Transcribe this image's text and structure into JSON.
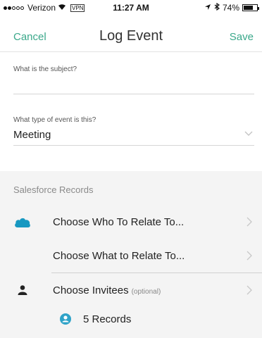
{
  "status_bar": {
    "carrier": "Verizon",
    "vpn": "VPN",
    "time": "11:27 AM",
    "battery": "74%",
    "battery_level": 0.74
  },
  "nav": {
    "cancel_label": "Cancel",
    "title": "Log Event",
    "save_label": "Save"
  },
  "form": {
    "subject_label": "What is the subject?",
    "subject_value": "",
    "event_type_label": "What type of event is this?",
    "event_type_value": "Meeting"
  },
  "salesforce": {
    "header": "Salesforce Records",
    "rows": [
      {
        "label": "Choose Who To Relate To...",
        "icon": "salesforce-cloud-icon"
      },
      {
        "label": "Choose What to Relate To..."
      },
      {
        "label": "Choose Invitees",
        "optional": "(optional)",
        "icon": "person-icon"
      }
    ],
    "records": {
      "label": "5 Records",
      "icon": "user-circle-icon"
    }
  },
  "colors": {
    "accent": "#3aa88a",
    "salesforce_blue": "#1798c1",
    "records_icon": "#2fa3c8"
  }
}
